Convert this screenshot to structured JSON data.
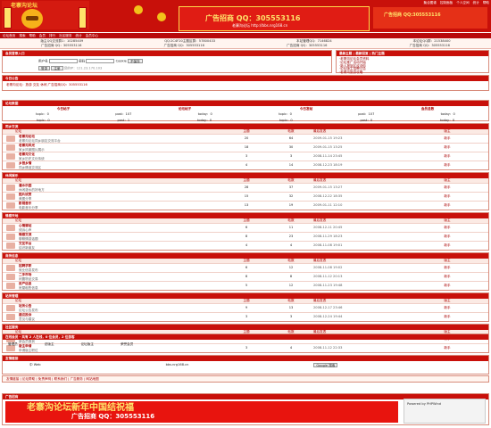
{
  "site": {
    "logo_text": "老寨沟论坛",
    "ad_main": "广告招商 QQ：305553116",
    "ad_main_sub": "老寨沟论坛 http://bbs.nrg168.cn",
    "ad_side": "广告招商 QQ:305553116"
  },
  "topnav": [
    "聚合图谱",
    "控制面板",
    "个人空间",
    "统计",
    "帮助"
  ],
  "menubar": [
    "论坛首页",
    "搜索",
    "帮助",
    "会员",
    "排行",
    "社区服务",
    "统计",
    "会员中心"
  ],
  "contact": {
    "row1": [
      "版主QQ交流群1：10285409",
      "QQ:2C4F20主题区群：57800433",
      "本站管理QQ：7146824",
      "本论坛QQ群：21538400"
    ],
    "row2": [
      "广告招商 QQ：305553116",
      "广告招商 QQ：305553116",
      "广告招商 QQ：305553116",
      "广告招商 QQ：305553116"
    ]
  },
  "login": {
    "head": "会员登录入口",
    "user_label": "用户名",
    "pass_label": "密码",
    "cookie_label": "Cookie",
    "cookie_value": "不保存",
    "login_button": "登录",
    "register_button": "注册",
    "tip": "您的IP：121.23.170.103"
  },
  "sidebox": {
    "head": "最新主题  |  最新回复  |  热门主题",
    "items": [
      "·老寨沟论坛会员资料",
      "·论坛推广活动开始",
      "·新人报到区欢迎你",
      "·论坛版主招聘公告",
      "·老寨沟旅游攻略"
    ]
  },
  "rotate": {
    "head": "今日公告",
    "text": "老寨沟论坛：旅游 交友 休闲 广告招商QQ：305553116"
  },
  "stats": {
    "head": "论坛数据",
    "cols": [
      "今日帖子",
      "论坛帖子",
      "今日发帖",
      "会员总数"
    ],
    "row1": [
      "topic：0",
      "post：107",
      "today：0",
      "topic：0",
      "post：107",
      "today：0"
    ],
    "row2": [
      "topic：0",
      "post：1",
      "today：0",
      "topic：0",
      "post：0",
      "today：0"
    ]
  },
  "cols": {
    "forum": "论坛",
    "topics": "主题",
    "posts": "帖数",
    "last": "最后发表",
    "mod": "版主"
  },
  "forums": [
    {
      "cat": "同乡交流",
      "rows": [
        [
          "老寨沟论坛",
          "老寨沟论坛同乡朋友交流平台",
          "20",
          "64",
          "2009-01-15 19:23",
          "新手"
        ],
        [
          "老寨沟风光",
          "家乡风景图片展示",
          "18",
          "30",
          "2009-01-15 13:25",
          "新手"
        ],
        [
          "老寨沟文化",
          "家乡历史文化传统",
          "3",
          "3",
          "2008-11-14 23:45",
          "新手"
        ],
        [
          "乡音乡情",
          "同乡情谊交流区",
          "4",
          "14",
          "2008-12-23 18:19",
          "新手"
        ]
      ]
    },
    {
      "cat": "休闲娱乐",
      "rows": [
        [
          "灌水乐园",
          "休闲灌水的好地方",
          "28",
          "37",
          "2009-01-15 13:27",
          "新手"
        ],
        [
          "图片欣赏",
          "美图分享",
          "15",
          "32",
          "2008-12-22 18:35",
          "新手"
        ],
        [
          "影视音乐",
          "电影音乐分享",
          "13",
          "19",
          "2009-01-11 12:10",
          "新手"
        ]
      ]
    },
    {
      "cat": "情感天地",
      "rows": [
        [
          "心情驿站",
          "倾诉心声",
          "6",
          "11",
          "2008-12-11 20:45",
          "新手"
        ],
        [
          "情感交流",
          "聊聊情感话题",
          "8",
          "23",
          "2008-11-29 18:23",
          "新手"
        ],
        [
          "交友平台",
          "结识新朋友",
          "4",
          "4",
          "2008-11-08 19:01",
          "新手"
        ]
      ]
    },
    {
      "cat": "商务信息",
      "rows": [
        [
          "招聘求职",
          "就业信息发布",
          "6",
          "12",
          "2008-11-08 19:02",
          "新手"
        ],
        [
          "二手市场",
          "闲置物品交易",
          "8",
          "8",
          "2008-11-12 20:13",
          "新手"
        ],
        [
          "房产信息",
          "房屋租售信息",
          "5",
          "12",
          "2008-11-23 19:48",
          "新手"
        ]
      ]
    },
    {
      "cat": "站务管理",
      "rows": [
        [
          "站务公告",
          "论坛公告发布",
          "9",
          "13",
          "2008-12-17 23:46",
          "新手"
        ],
        [
          "建议投诉",
          "意见与建议",
          "3",
          "3",
          "2008-12-24 19:44",
          "新手"
        ]
      ]
    },
    {
      "cat": "社区服务",
      "rows": [
        [
          "新人报到",
          "新会员报到",
          "4",
          "5",
          "2008-12-14 16:11",
          "新手"
        ],
        [
          "版主申请",
          "申请版主职位",
          "3",
          "4",
          "2008-11-12 22:33",
          "新手"
        ]
      ]
    }
  ],
  "online": {
    "head": "在线会员 - 共有 2 人在线，0 位会员，2 位游客",
    "items": [
      "管理员",
      "总版主",
      "论坛版主",
      "荣誉会员"
    ]
  },
  "links": {
    "head": "友情链接",
    "item1": "中 Web",
    "item2": "bbs.nrg168.cn",
    "search_button": "Google 搜索"
  },
  "search": {
    "text": "友情链接 | 论坛帮助 | 免责声明 | 联系我们 | 广告服务 | 网站地图"
  },
  "footer": {
    "head": "广告招商",
    "ad_text": "老寨沟论坛新年中国结祝福",
    "ad_sub": "广告招商 QQ：305553116",
    "powered": "Powered by PHPWind"
  }
}
